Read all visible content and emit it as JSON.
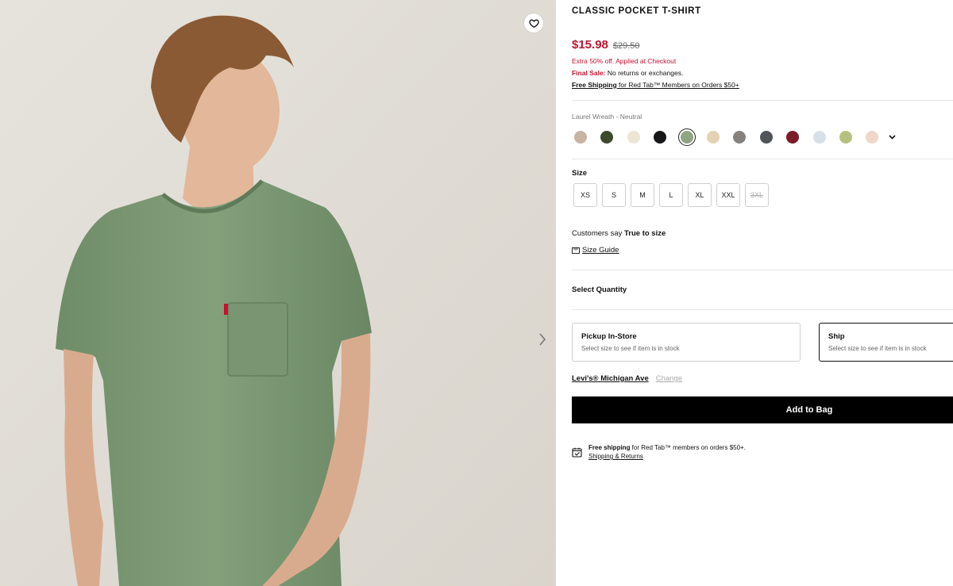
{
  "product": {
    "title": "CLASSIC POCKET T-SHIRT",
    "price_sale": "$15.98",
    "price_original": "$29.50",
    "promo": "Extra 50% off. Applied at Checkout",
    "final_sale_label": "Final Sale:",
    "final_sale_text": " No returns or exchanges.",
    "free_shipping_link": "Free Shipping",
    "free_shipping_text": " for Red Tab™ Members on Orders $50+"
  },
  "colors": {
    "selected_name": "Laurel Wreath - Neutral",
    "selected_index": 4,
    "swatches": [
      {
        "icon": "swatch-icon",
        "hex": "#c8b4a3"
      },
      {
        "icon": "swatch-icon",
        "hex": "#3e4a2c"
      },
      {
        "icon": "swatch-icon",
        "hex": "#ece5d4"
      },
      {
        "icon": "swatch-icon",
        "hex": "#17171a"
      },
      {
        "icon": "swatch-icon",
        "hex": "#8ea583"
      },
      {
        "icon": "swatch-icon",
        "hex": "#e3d2b3"
      },
      {
        "icon": "swatch-icon",
        "hex": "#86817c"
      },
      {
        "icon": "swatch-icon",
        "hex": "#505357"
      },
      {
        "icon": "swatch-icon",
        "hex": "#7b1c26"
      },
      {
        "icon": "swatch-icon",
        "hex": "#d5e0e8"
      },
      {
        "icon": "swatch-icon",
        "hex": "#b7c17f"
      },
      {
        "icon": "swatch-icon",
        "hex": "#f0d6c6"
      }
    ]
  },
  "sizes": {
    "label": "Size",
    "options": [
      "XS",
      "S",
      "M",
      "L",
      "XL",
      "XXL",
      "3XL"
    ],
    "unavailable": [
      "3XL"
    ]
  },
  "fit": {
    "prefix": "Customers say ",
    "value": "True to size",
    "guide_label": "Size Guide"
  },
  "quantity": {
    "label": "Select Quantity"
  },
  "fulfillment": {
    "pickup_title": "Pickup In-Store",
    "pickup_sub": "Select size to see if item is in stock",
    "ship_title": "Ship",
    "ship_sub": "Select size to see if item is in stock",
    "store_name": "Levi's® Michigan Ave",
    "change_label": "Change"
  },
  "cart": {
    "add_label": "Add to Bag"
  },
  "shipping_info": {
    "bold": "Free shipping",
    "text": " for Red Tab™ members on orders $50+.",
    "link": "Shipping & Returns"
  },
  "theme": {
    "accent": "#c41230",
    "photo_bg": "#e4e0da",
    "shirt": "#7d9a75"
  },
  "icons": {
    "wishlist": "heart-icon",
    "next": "chevron-right-icon",
    "more_colors": "chevron-down-icon",
    "size_guide": "ruler-icon",
    "shipping": "calendar-check-icon"
  }
}
